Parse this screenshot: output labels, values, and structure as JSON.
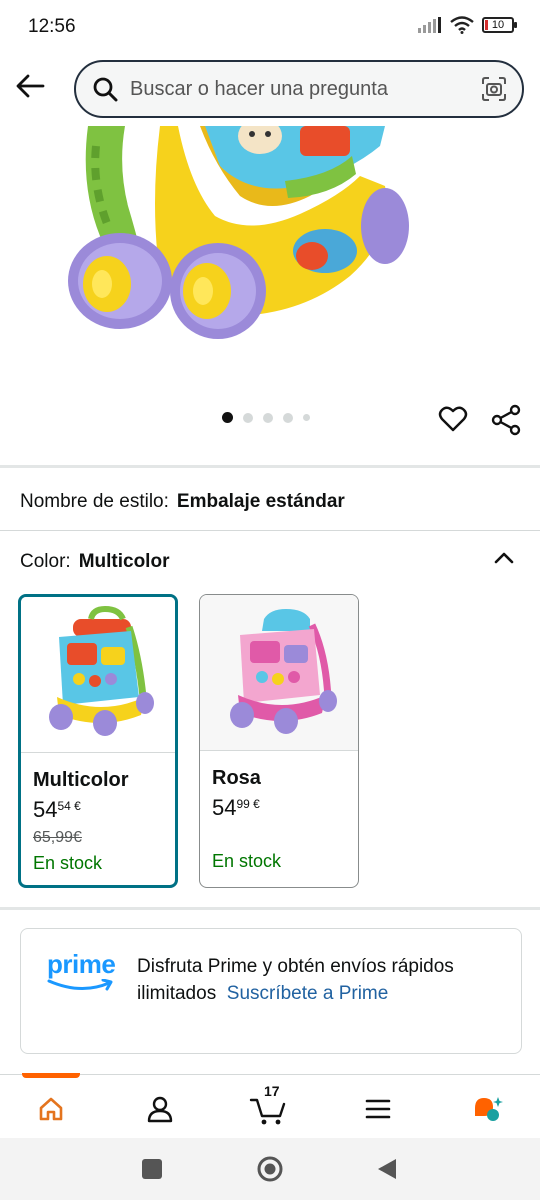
{
  "status": {
    "time": "12:56",
    "battery": "10"
  },
  "search": {
    "placeholder": "Buscar o hacer una pregunta"
  },
  "style_row": {
    "label": "Nombre de estilo:",
    "value": "Embalaje estándar"
  },
  "color_row": {
    "label": "Color:",
    "value": "Multicolor"
  },
  "variants": [
    {
      "name": "Multicolor",
      "price_whole": "54",
      "price_fraction": "54 €",
      "old_price": "65,99€",
      "stock": "En stock"
    },
    {
      "name": "Rosa",
      "price_whole": "54",
      "price_fraction": "99 €",
      "stock": "En stock"
    }
  ],
  "prime": {
    "logo_text": "prime",
    "message": "Disfruta Prime y obtén envíos rápidos ilimitados",
    "link": "Suscríbete a Prime"
  },
  "nav": {
    "cart_count": "17"
  },
  "colors": {
    "accent_teal": "#007185",
    "stock_green": "#007600",
    "prime_blue": "#1a98ff",
    "link_blue": "#2162a1",
    "home_orange": "#ff6200"
  },
  "icons": [
    "back-arrow-icon",
    "search-icon",
    "camera-lens-icon",
    "heart-icon",
    "share-icon",
    "chevron-up-icon",
    "home-icon",
    "account-icon",
    "cart-icon",
    "menu-icon",
    "rufus-icon"
  ],
  "carousel": {
    "total_images": 5,
    "active_index": 0
  }
}
